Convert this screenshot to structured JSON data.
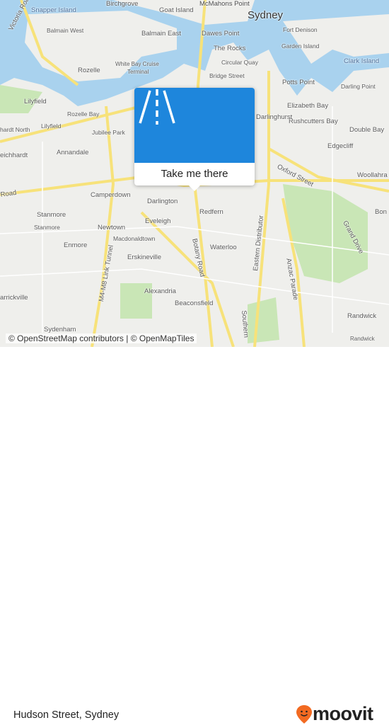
{
  "map": {
    "labels": [
      "Victoria Road",
      "Snapper Island",
      "Birchgrove",
      "Goat Island",
      "McMahons Point",
      "Sydney",
      "Balmain West",
      "Balmain East",
      "Dawes Point",
      "Fort Denison",
      "Garden Island",
      "The Rocks",
      "Clark Island",
      "Rozelle",
      "White Bay Cruise",
      "Terminal",
      "Circular Quay",
      "Bridge Street",
      "Potts Point",
      "Darling Point",
      "Lilyfield",
      "Rozelle Bay",
      "Elizabeth Bay",
      "Rushcutters Bay",
      "hardt North",
      "Lilyfield",
      "Jubilee Park",
      "Darlinghurst",
      "Double Bay",
      "Edgecliff",
      "eichhardt",
      "Annandale",
      "Oxford Street",
      "Woollahra",
      "Road",
      "Camperdown",
      "Darlington",
      "Redfern",
      "Bon",
      "Stanmore",
      "Stanmore",
      "Newtown",
      "Eveleigh",
      "Macdonaldtown",
      "Enmore",
      "Eastern Distributor",
      "Grand Drive",
      "Botany Road",
      "Waterloo",
      "Anzac Parade",
      "M4-M8 Link Tunnel",
      "Erskineville",
      "Alexandria",
      "arrickville",
      "Beaconsfield",
      "Southern",
      "Randwick",
      "Randwick",
      "Sydenham"
    ],
    "water_color": "#a9d2ee",
    "land_color": "#efefec",
    "park_color": "#c9e6b6",
    "road_color": "#f7e27a"
  },
  "popup": {
    "icon": "road-icon",
    "button_label": "Take me there",
    "color": "#1e86dc"
  },
  "attribution": "© OpenStreetMap contributors | © OpenMapTiles",
  "footer": {
    "place": "Hudson Street, Sydney",
    "brand": "moovit",
    "brand_color": "#f26a21"
  }
}
